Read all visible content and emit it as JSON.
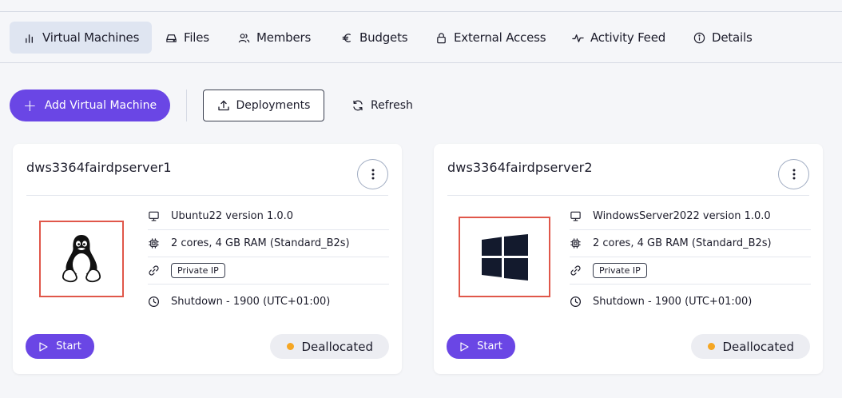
{
  "tabs": [
    {
      "label": "Virtual Machines",
      "icon": "bar-chart-icon",
      "active": true
    },
    {
      "label": "Files",
      "icon": "drive-icon"
    },
    {
      "label": "Members",
      "icon": "users-icon"
    },
    {
      "label": "Budgets",
      "icon": "euro-icon"
    },
    {
      "label": "External Access",
      "icon": "lock-icon"
    },
    {
      "label": "Activity Feed",
      "icon": "activity-icon"
    },
    {
      "label": "Details",
      "icon": "info-icon"
    }
  ],
  "toolbar": {
    "add_vm_label": "Add Virtual Machine",
    "deployments_label": "Deployments",
    "refresh_label": "Refresh"
  },
  "vms": [
    {
      "name": "dws3364fairdpserver1",
      "os_icon": "linux-tux-icon",
      "image": "Ubuntu22 version 1.0.0",
      "size": "2 cores, 4 GB RAM (Standard_B2s)",
      "network": "Private IP",
      "shutdown": "Shutdown -  1900  (UTC+01:00)",
      "start_label": "Start",
      "status": "Deallocated"
    },
    {
      "name": "dws3364fairdpserver2",
      "os_icon": "windows-logo-icon",
      "image": "WindowsServer2022 version 1.0.0",
      "size": "2 cores, 4 GB RAM (Standard_B2s)",
      "network": "Private IP",
      "shutdown": "Shutdown -  1900  (UTC+01:00)",
      "start_label": "Start",
      "status": "Deallocated"
    }
  ],
  "colors": {
    "accent": "#6a46e5",
    "status_dot": "#f5a623",
    "highlight_border": "#e0574a"
  }
}
